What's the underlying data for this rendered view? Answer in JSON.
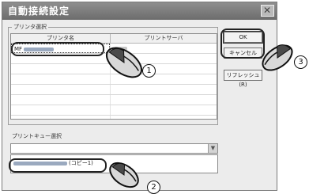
{
  "window": {
    "title": "自動接続設定",
    "close_glyph": "✕"
  },
  "printer_group": {
    "legend": "プリンタ選択",
    "columns": [
      "プリンタ名",
      "プリントサーバ"
    ],
    "rows": [
      {
        "name": "MF",
        "server": ""
      }
    ],
    "empty_rows": 7
  },
  "buttons": {
    "ok": "OK",
    "cancel": "キャンセル",
    "refresh": "リフレッシュ(R)"
  },
  "queue_group": {
    "label": "プリントキュー選択",
    "combo_value": "",
    "dropdown_item_suffix": "(コピー1)"
  },
  "callouts": {
    "step1": "1",
    "step2": "2",
    "step3": "3"
  }
}
